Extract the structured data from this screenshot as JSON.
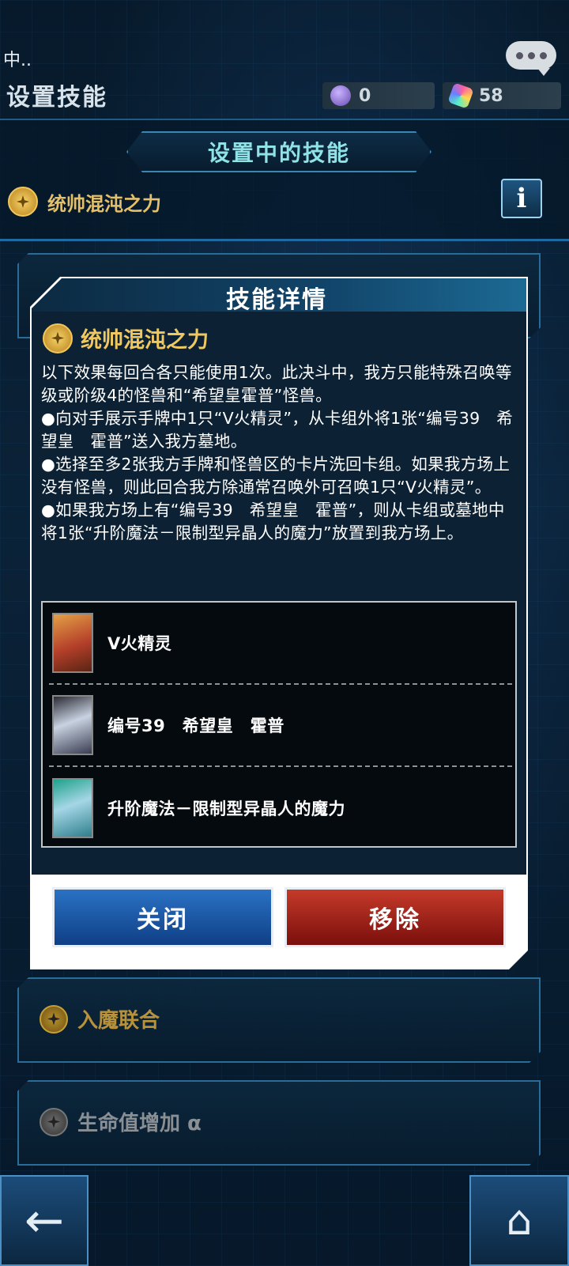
{
  "status_left": "中..",
  "page_title": "设置技能",
  "currency": [
    {
      "value": "0"
    },
    {
      "value": "58"
    }
  ],
  "section_title": "设置中的技能",
  "active_skill": {
    "name": "统帅混沌之力"
  },
  "info_label": "i",
  "skill_list": [
    {
      "name": "入魔联合"
    },
    {
      "name": "生命值增加 α"
    }
  ],
  "modal": {
    "title": "技能详情",
    "skill_name": "统帅混沌之力",
    "description": "以下效果每回合各只能使用1次。此决斗中，我方只能特殊召唤等级或阶级4的怪兽和“希望皇霍普”怪兽。\n●向对手展示手牌中1只“V火精灵”，从卡组外将1张“编号39　希望皇　霍普”送入我方墓地。\n●选择至多2张我方手牌和怪兽区的卡片洗回卡组。如果我方场上没有怪兽，则此回合我方除通常召唤外可召唤1只“V火精灵”。\n●如果我方场上有“编号39　希望皇　霍普”，则从卡组或墓地中将1张“升阶魔法－限制型异晶人的魔力”放置到我方场上。",
    "cards": [
      {
        "name": "V火精灵"
      },
      {
        "name": "编号39　希望皇　霍普"
      },
      {
        "name": "升阶魔法－限制型异晶人的魔力"
      }
    ],
    "close_label": "关闭",
    "remove_label": "移除"
  },
  "nav": {
    "back_icon": "back-arrow-icon",
    "home_icon": "home-icon"
  },
  "colors": {
    "gold": "#efc860",
    "close_blue": "#1f5aa8",
    "remove_red": "#a8241b"
  }
}
